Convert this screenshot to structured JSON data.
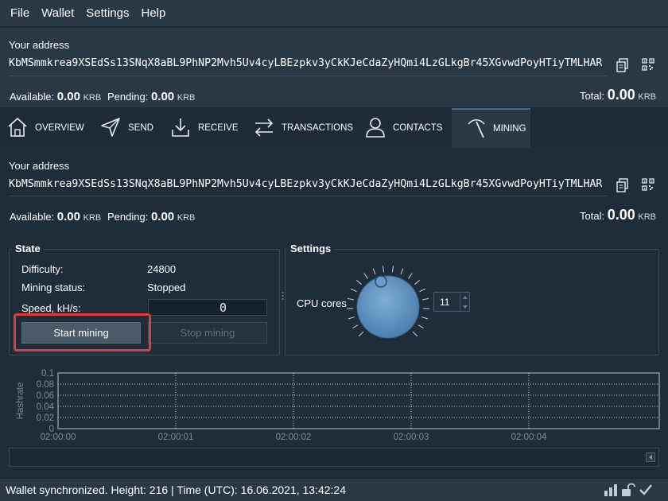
{
  "menu": [
    "File",
    "Wallet",
    "Settings",
    "Help"
  ],
  "header": {
    "address_label": "Your address",
    "address": "KbMSmmkrea9XSEdSs13SNqX8aBL9PhNP2Mvh5Uv4cyLBEzpkv3yCkKJeCdaZyHQmi4LzGLkgBr45XGvwdPoyHTiyTMLHAR",
    "available_label": "Available:",
    "available_value": "0.00",
    "pending_label": "Pending:",
    "pending_value": "0.00",
    "unit": "KRB",
    "total_label": "Total:",
    "total_value": "0.00"
  },
  "tabs": [
    {
      "label": "OVERVIEW",
      "icon": "home-icon"
    },
    {
      "label": "SEND",
      "icon": "send-icon"
    },
    {
      "label": "RECEIVE",
      "icon": "receive-icon"
    },
    {
      "label": "TRANSACTIONS",
      "icon": "transactions-icon"
    },
    {
      "label": "CONTACTS",
      "icon": "contacts-icon"
    },
    {
      "label": "MINING",
      "icon": "pickaxe-icon",
      "active": true
    }
  ],
  "mining": {
    "address_label": "Your address",
    "address": "KbMSmmkrea9XSEdSs13SNqX8aBL9PhNP2Mvh5Uv4cyLBEzpkv3yCkKJeCdaZyHQmi4LzGLkgBr45XGvwdPoyHTiyTMLHAR",
    "available_label": "Available:",
    "available_value": "0.00",
    "pending_label": "Pending:",
    "pending_value": "0.00",
    "unit": "KRB",
    "total_label": "Total:",
    "total_value": "0.00",
    "state": {
      "title": "State",
      "difficulty_label": "Difficulty:",
      "difficulty_value": "24800",
      "status_label": "Mining status:",
      "status_value": "Stopped",
      "speed_label": "Speed, kH/s:",
      "speed_value": "0",
      "start_label": "Start mining",
      "stop_label": "Stop mining"
    },
    "settings": {
      "title": "Settings",
      "cpu_label": "CPU cores",
      "cpu_value": "11"
    }
  },
  "chart_data": {
    "type": "line",
    "ylabel": "Hashrate",
    "xlabel": "",
    "x_ticks": [
      "02:00:00",
      "02:00:01",
      "02:00:02",
      "02:00:03",
      "02:00:04"
    ],
    "y_ticks": [
      "0",
      "0.02",
      "0.04",
      "0.06",
      "0.08",
      "0.1"
    ],
    "ylim": [
      0,
      0.1
    ],
    "grid": true,
    "series": []
  },
  "statusbar": {
    "text": "Wallet synchronized. Height: 216  |  Time (UTC): 16.06.2021, 13:42:24"
  },
  "colors": {
    "background": "#1f2c39",
    "panel": "#2a3846",
    "highlight": "#e13a3a",
    "knob": "#5a8fc0"
  }
}
